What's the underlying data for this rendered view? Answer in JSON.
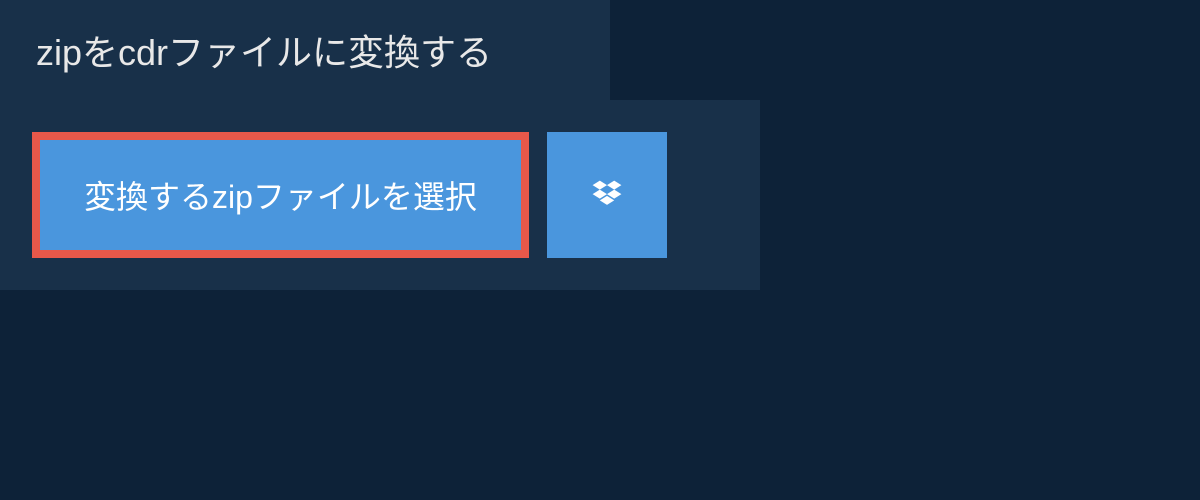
{
  "header": {
    "title": "zipをcdrファイルに変換する"
  },
  "actions": {
    "select_file_label": "変換するzipファイルを選択"
  }
}
